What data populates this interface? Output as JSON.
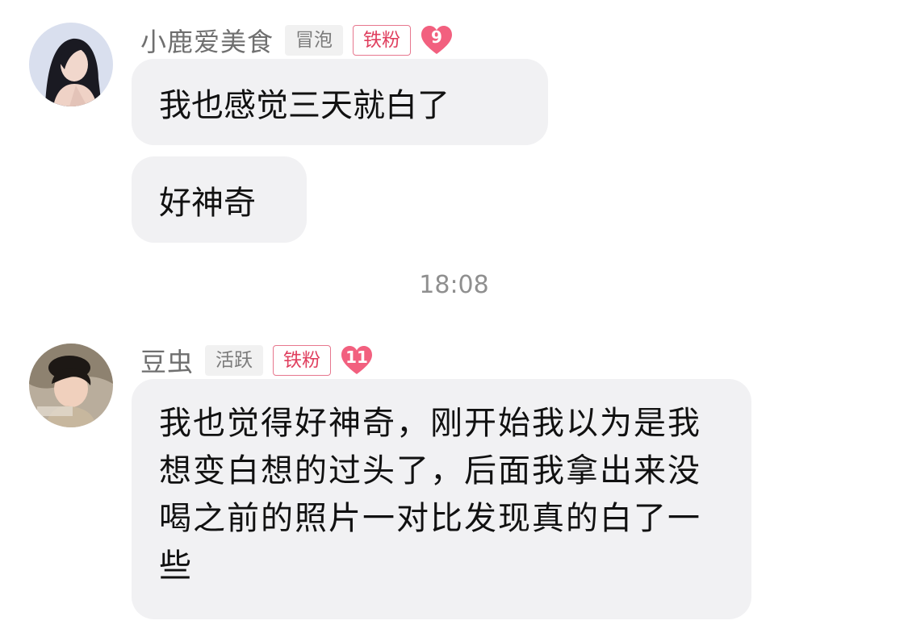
{
  "messages": [
    {
      "username": "小鹿爱美食",
      "level_tag": "冒泡",
      "fan_tag": "铁粉",
      "badge_number": "9",
      "bubbles": [
        "我也感觉三天就白了",
        "好神奇"
      ]
    },
    {
      "username": "豆虫",
      "level_tag": "活跃",
      "fan_tag": "铁粉",
      "badge_number": "11",
      "bubbles": [
        "我也觉得好神奇，刚开始我以为是我想变白想的过头了，后面我拿出来没喝之前的照片一对比发现真的白了一些"
      ]
    }
  ],
  "timestamp": "18:08",
  "colors": {
    "bubble_bg": "#f1f1f3",
    "fan_tag": "#e0405f",
    "heart": "#f2607f"
  }
}
